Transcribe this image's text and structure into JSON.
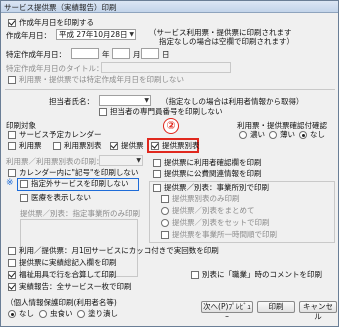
{
  "window": {
    "title": "サービス提供票（実績報告）印刷"
  },
  "top": {
    "print_date_cb": "作成年月日を印刷する",
    "print_date_label": "作成年月日：",
    "print_date_value": "平成 27年10月28日",
    "note_line1": "（サービス利用票・提供票に印刷されます",
    "note_line2": "指定なしの場合は空欄で印刷されます）",
    "special_date_label": "特定作成年月日：",
    "year_label": "年",
    "month_label": "月",
    "day_label": "日",
    "special_title_label": "特定作成年月日のタイトル：",
    "special_title_cb": "利用票・提供票では特定作成年月日を印刷しない"
  },
  "tanto": {
    "label": "担当者氏名：",
    "note": "（指定なしの場合は利用者情報から取得）",
    "cb": "担当者の専門員番号を印刷しない"
  },
  "print_target": {
    "heading": "印刷対象",
    "service_calendar": "サービス予定カレンダー",
    "riyohyo": "利用票",
    "riyohyo_betsu": "利用票別表",
    "teikyohyo": "提供票",
    "teikyohyo_betsu": "提供票別表"
  },
  "seal": {
    "heading": "利用票・提供票確認付確認",
    "options": [
      "濃い",
      "薄い",
      "なし"
    ],
    "selected": "なし"
  },
  "left_options": {
    "kubun_label": "利用票／利用票別表の印刷：",
    "calendar_cb": "カレンダー内に\"記号\"を印刷しない",
    "flatten_cb": "指定外サービスを印刷しない",
    "hide_sakuhi": "医療を表示しない",
    "riyohyo_betsu_label": "提供票／別表：指定事業所のみ印刷"
  },
  "right_options": {
    "r1": "提供票に利用者確認欄を印刷",
    "r2": "提供票に公費関連情報を印刷",
    "r3": "提供票／別表：事業所別で印刷",
    "r4": "提供票別表のみ印刷",
    "r5a": "提供票／別表をまとめて",
    "r5b": "提供票／別表をセットで印刷",
    "r6": "提供票を事業所一時間順で印刷"
  },
  "bottom_options": {
    "b1": "利用／提供票：月1回サービスにカッコ付きで実回数を印刷",
    "b2": "提供票に実績総記入欄を印刷",
    "b3": "福祉用具で行を合算して印刷",
    "b3r": "別表に「職業」時のコメントを印刷",
    "b4": "実績報告：全サービス一枚で印刷"
  },
  "privacy": {
    "heading": "（個人情報保護印刷(利用者名等)",
    "options": [
      "なし",
      "虫食い",
      "塗り潰し"
    ],
    "selected": "なし"
  },
  "buttons": {
    "next": "次へ(P)ﾌﾟﾚﾋﾞｭｰ",
    "ok": "印刷",
    "cancel": "キャンセル"
  },
  "annotations": {
    "badge": "②",
    "star": "※"
  }
}
